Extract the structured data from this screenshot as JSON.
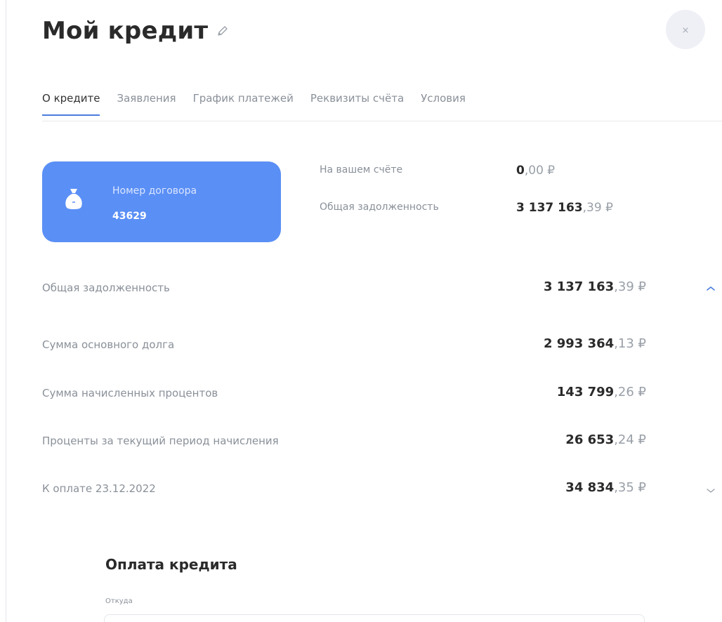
{
  "header": {
    "title": "Мой кредит"
  },
  "tabs": [
    {
      "label": "О кредите",
      "active": true
    },
    {
      "label": "Заявления",
      "active": false
    },
    {
      "label": "График платежей",
      "active": false
    },
    {
      "label": "Реквизиты счёта",
      "active": false
    },
    {
      "label": "Условия",
      "active": false
    }
  ],
  "contract_card": {
    "label": "Номер договора",
    "number": "43629",
    "color": "#5a8ff5"
  },
  "summary": {
    "account_label": "На вашем счёте",
    "account_int": "0",
    "account_frac": ",00 ₽",
    "debt_label": "Общая задолженность",
    "debt_int": "3 137 163",
    "debt_frac": ",39 ₽"
  },
  "details": {
    "total_debt": {
      "label": "Общая задолженность",
      "int": "3 137 163",
      "frac": ",39 ₽"
    },
    "principal": {
      "label": "Сумма основного долга",
      "int": "2 993 364",
      "frac": ",13 ₽"
    },
    "interest": {
      "label": "Сумма начисленных процентов",
      "int": "143 799",
      "frac": ",26 ₽"
    },
    "current_interest": {
      "label": "Проценты за текущий период начисления",
      "int": "26 653",
      "frac": ",24 ₽"
    },
    "due": {
      "label": "К оплате 23.12.2022",
      "int": "34 834",
      "frac": ",35 ₽"
    }
  },
  "payment": {
    "title": "Оплата кредита",
    "from_label": "Откуда"
  },
  "icons": {
    "edit": "pencil-icon",
    "close": "close-icon",
    "bag": "money-bag-icon",
    "collapse": "chevron-up-icon",
    "expand": "chevron-down-icon"
  },
  "colors": {
    "accent": "#4a7cdf",
    "card": "#5a8ff5"
  }
}
